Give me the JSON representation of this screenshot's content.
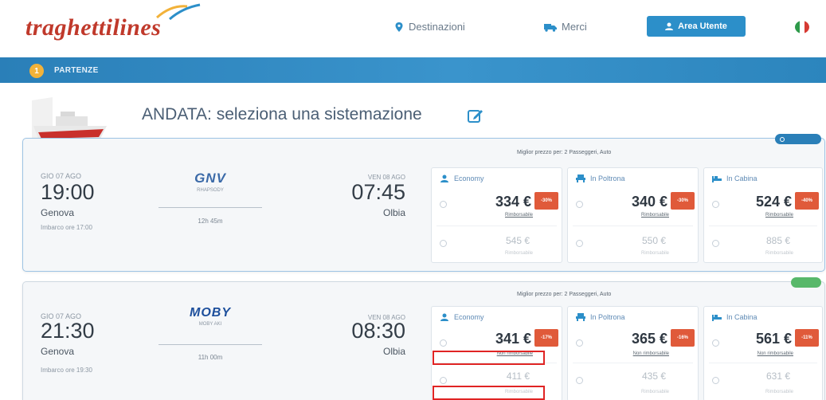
{
  "header": {
    "logo": "traghettilines",
    "nav": {
      "destinations": "Destinazioni",
      "freight": "Merci"
    },
    "user_area_button": "Area Utente",
    "colors": {
      "brand_red": "#c0392b",
      "accent_blue": "#2c8fc9",
      "step_bar": "#2a7fb8"
    }
  },
  "step": {
    "number": "1",
    "label": "PARTENZE"
  },
  "page_title": "ANDATA: seleziona una sistemazione",
  "routes": [
    {
      "badge": "",
      "best_price_note": "Miglior prezzo per: 2 Passeggeri, Auto",
      "departure": {
        "date": "GIO 07 AGO",
        "time": "19:00",
        "city": "Genova",
        "boarding": "Imbarco ore 17:00"
      },
      "carrier": {
        "name": "GNV",
        "ship": "RHAPSODY",
        "duration": "12h 45m"
      },
      "arrival": {
        "date": "VEN 08 AGO",
        "time": "07:45",
        "city": "Olbia"
      },
      "classes": [
        {
          "name": "Economy",
          "icon": "person-icon",
          "price": "334 €",
          "note": "Rimborsabile",
          "discount": "-30%",
          "alt_price": "545 €",
          "alt_note": "Rimborsabile"
        },
        {
          "name": "In Poltrona",
          "icon": "armchair-icon",
          "price": "340 €",
          "note": "Rimborsabile",
          "discount": "-30%",
          "alt_price": "550 €",
          "alt_note": "Rimborsabile"
        },
        {
          "name": "In Cabina",
          "icon": "bed-icon",
          "price": "524 €",
          "note": "Rimborsabile",
          "discount": "-40%",
          "alt_price": "885 €",
          "alt_note": "Rimborsabile"
        }
      ]
    },
    {
      "badge": "",
      "best_price_note": "Miglior prezzo per: 2 Passeggeri, Auto",
      "departure": {
        "date": "GIO 07 AGO",
        "time": "21:30",
        "city": "Genova",
        "boarding": "Imbarco ore 19:30"
      },
      "carrier": {
        "name": "MOBY",
        "ship": "MOBY AKI",
        "duration": "11h 00m"
      },
      "arrival": {
        "date": "VEN 08 AGO",
        "time": "08:30",
        "city": "Olbia"
      },
      "classes": [
        {
          "name": "Economy",
          "icon": "person-icon",
          "price": "341 €",
          "note": "Non rimborsabile",
          "discount": "-17%",
          "alt_price": "411 €",
          "alt_note": "Rimborsabile"
        },
        {
          "name": "In Poltrona",
          "icon": "armchair-icon",
          "price": "365 €",
          "note": "Non rimborsabile",
          "discount": "-16%",
          "alt_price": "435 €",
          "alt_note": "Rimborsabile"
        },
        {
          "name": "In Cabina",
          "icon": "bed-icon",
          "price": "561 €",
          "note": "Non rimborsabile",
          "discount": "-11%",
          "alt_price": "631 €",
          "alt_note": "Rimborsabile"
        }
      ]
    }
  ]
}
